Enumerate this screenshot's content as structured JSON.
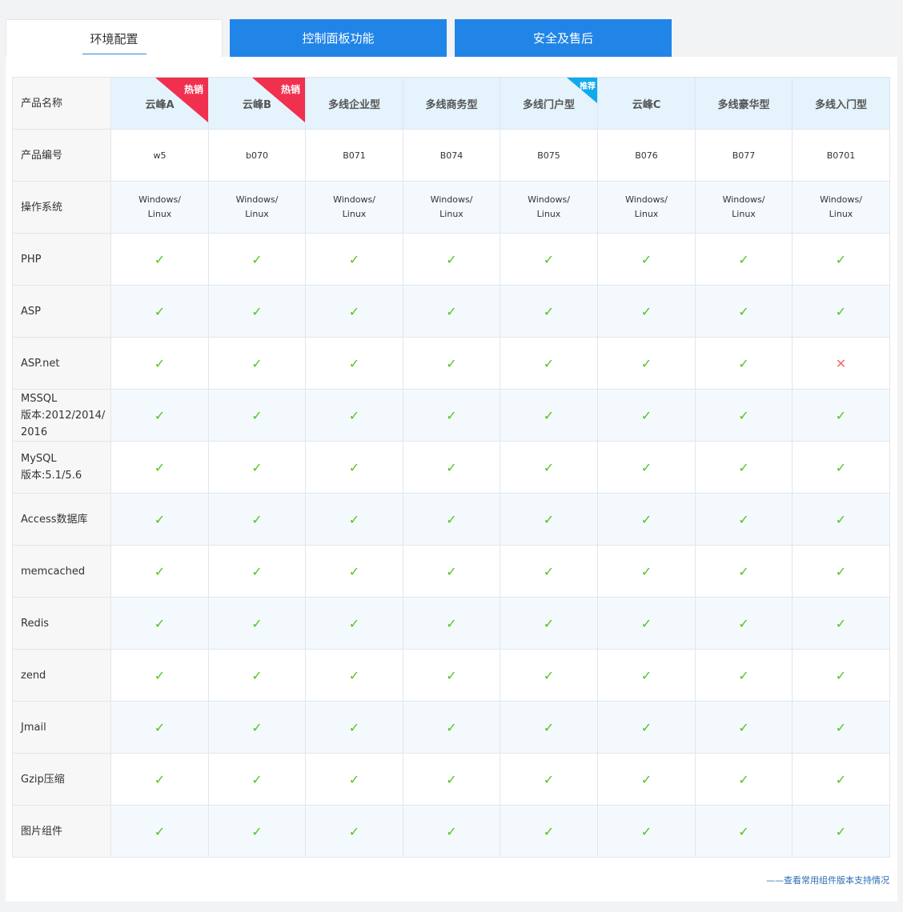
{
  "tabs": [
    {
      "label": "环境配置",
      "active": true
    },
    {
      "label": "控制面板功能",
      "active": false
    },
    {
      "label": "安全及售后",
      "active": false
    }
  ],
  "table": {
    "header_label": "产品名称",
    "products": [
      {
        "name": "云峰A",
        "badge": "热销",
        "badge_type": "hot"
      },
      {
        "name": "云峰B",
        "badge": "热销",
        "badge_type": "hot"
      },
      {
        "name": "多线企业型",
        "badge": "",
        "badge_type": ""
      },
      {
        "name": "多线商务型",
        "badge": "",
        "badge_type": ""
      },
      {
        "name": "多线门户型",
        "badge": "推荐",
        "badge_type": "rec"
      },
      {
        "name": "云峰C",
        "badge": "",
        "badge_type": ""
      },
      {
        "name": "多线豪华型",
        "badge": "",
        "badge_type": ""
      },
      {
        "name": "多线入门型",
        "badge": "",
        "badge_type": ""
      }
    ],
    "code_row": {
      "label": "产品编号",
      "values": [
        "w5",
        "b070",
        "B071",
        "B074",
        "B075",
        "B076",
        "B077",
        "B0701"
      ]
    },
    "os_row": {
      "label": "操作系统",
      "line1": "Windows/",
      "line2": "Linux"
    },
    "feature_rows": [
      {
        "label": "PHP",
        "support": [
          true,
          true,
          true,
          true,
          true,
          true,
          true,
          true
        ]
      },
      {
        "label": "ASP",
        "support": [
          true,
          true,
          true,
          true,
          true,
          true,
          true,
          true
        ]
      },
      {
        "label": "ASP.net",
        "support": [
          true,
          true,
          true,
          true,
          true,
          true,
          true,
          false
        ]
      },
      {
        "label": "MSSQL\n版本:2012/2014/\n2016",
        "support": [
          true,
          true,
          true,
          true,
          true,
          true,
          true,
          true
        ]
      },
      {
        "label": "MySQL\n版本:5.1/5.6",
        "support": [
          true,
          true,
          true,
          true,
          true,
          true,
          true,
          true
        ]
      },
      {
        "label": "Access数据库",
        "support": [
          true,
          true,
          true,
          true,
          true,
          true,
          true,
          true
        ]
      },
      {
        "label": "memcached",
        "support": [
          true,
          true,
          true,
          true,
          true,
          true,
          true,
          true
        ]
      },
      {
        "label": "Redis",
        "support": [
          true,
          true,
          true,
          true,
          true,
          true,
          true,
          true
        ]
      },
      {
        "label": "zend",
        "support": [
          true,
          true,
          true,
          true,
          true,
          true,
          true,
          true
        ]
      },
      {
        "label": "Jmail",
        "support": [
          true,
          true,
          true,
          true,
          true,
          true,
          true,
          true
        ]
      },
      {
        "label": "Gzip压缩",
        "support": [
          true,
          true,
          true,
          true,
          true,
          true,
          true,
          true
        ]
      },
      {
        "label": "图片组件",
        "support": [
          true,
          true,
          true,
          true,
          true,
          true,
          true,
          true
        ]
      }
    ],
    "check_symbol": "✓",
    "cross_symbol": "✕"
  },
  "footer_link": "——查看常用组件版本支持情况",
  "colors": {
    "tab_blue": "#2185e8",
    "check": "#52c41a",
    "cross": "#f26b6b",
    "hot": "#f1304f",
    "recommend": "#11aaea"
  }
}
